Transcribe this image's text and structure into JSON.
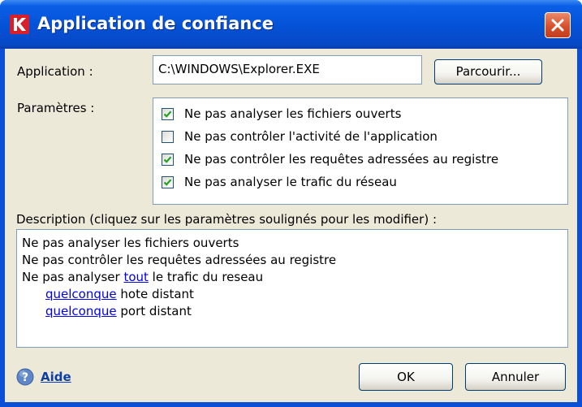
{
  "window": {
    "title": "Application de confiance"
  },
  "application": {
    "label": "Application :",
    "path": "C:\\WINDOWS\\Explorer.EXE",
    "browse_label": "Parcourir..."
  },
  "parameters": {
    "label": "Paramètres :",
    "options": [
      {
        "label": "Ne pas analyser les fichiers ouverts",
        "checked": true
      },
      {
        "label": "Ne pas contrôler l'activité de l'application",
        "checked": false
      },
      {
        "label": "Ne pas contrôler les requêtes adressées au registre",
        "checked": true
      },
      {
        "label": "Ne pas analyser le trafic du réseau",
        "checked": true
      }
    ]
  },
  "description": {
    "label": "Description (cliquez sur les paramètres soulignés pour les modifier) :",
    "line1": "Ne pas analyser les fichiers ouverts",
    "line2": "Ne pas contrôler les requêtes adressées au registre",
    "line3_prefix": "Ne pas analyser ",
    "line3_link": "tout",
    "line3_suffix": " le trafic du reseau",
    "host_link": "quelconque",
    "host_text": " hote distant",
    "port_link": "quelconque",
    "port_text": " port distant"
  },
  "footer": {
    "help_label": "Aide",
    "ok_label": "OK",
    "cancel_label": "Annuler"
  },
  "icons": {
    "app": "kaspersky-k-icon",
    "close": "close-icon",
    "help": "help-icon",
    "check": "checkmark-icon"
  },
  "colors": {
    "title_bar": "#0553d8",
    "dialog_bg": "#ece9d8",
    "close_button": "#d8502c",
    "link": "#0000ee"
  }
}
